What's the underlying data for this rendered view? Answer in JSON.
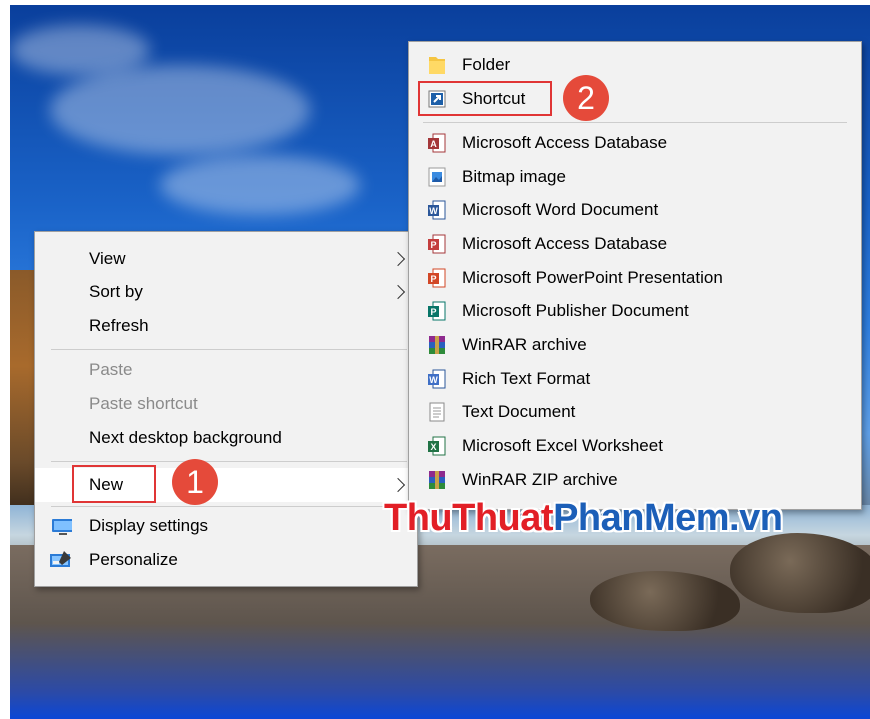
{
  "context_menu": {
    "items": [
      {
        "label": "View"
      },
      {
        "label": "Sort by"
      },
      {
        "label": "Refresh"
      },
      {
        "label": "Paste"
      },
      {
        "label": "Paste shortcut"
      },
      {
        "label": "Next desktop background"
      },
      {
        "label": "New"
      },
      {
        "label": "Display settings"
      },
      {
        "label": "Personalize"
      }
    ]
  },
  "new_submenu": {
    "items": [
      {
        "label": "Folder",
        "icon": "folder-icon"
      },
      {
        "label": "Shortcut",
        "icon": "shortcut-icon"
      },
      {
        "label": "Microsoft Access Database",
        "icon": "access-icon"
      },
      {
        "label": "Bitmap image",
        "icon": "bitmap-icon"
      },
      {
        "label": "Microsoft Word Document",
        "icon": "word-icon"
      },
      {
        "label": "Microsoft Access Database",
        "icon": "access-icon"
      },
      {
        "label": "Microsoft PowerPoint Presentation",
        "icon": "powerpoint-icon"
      },
      {
        "label": "Microsoft Publisher Document",
        "icon": "publisher-icon"
      },
      {
        "label": "WinRAR archive",
        "icon": "winrar-icon"
      },
      {
        "label": "Rich Text Format",
        "icon": "rtf-icon"
      },
      {
        "label": "Text Document",
        "icon": "text-document-icon"
      },
      {
        "label": "Microsoft Excel Worksheet",
        "icon": "excel-icon"
      },
      {
        "label": "WinRAR ZIP archive",
        "icon": "winrar-zip-icon"
      }
    ]
  },
  "annotations": {
    "step1": "1",
    "step2": "2"
  },
  "watermark": {
    "part1": "ThuThuat",
    "part2": "PhanMem",
    "part3": ".vn"
  },
  "colors": {
    "menu_bg": "#f2f2f2",
    "highlight_box": "#e03535",
    "badge": "#e54a3a"
  }
}
